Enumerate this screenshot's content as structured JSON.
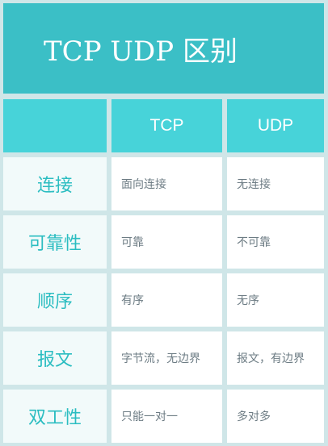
{
  "title": "TCP UDP 区别",
  "columns": [
    "",
    "TCP",
    "UDP"
  ],
  "rows": [
    {
      "label": "连接",
      "tcp": "面向连接",
      "udp": "无连接"
    },
    {
      "label": "可靠性",
      "tcp": "可靠",
      "udp": "不可靠"
    },
    {
      "label": "顺序",
      "tcp": "有序",
      "udp": "无序"
    },
    {
      "label": "报文",
      "tcp": "字节流，无边界",
      "udp": "报文，有边界"
    },
    {
      "label": "双工性",
      "tcp": "只能一对一",
      "udp": "多对多"
    }
  ],
  "colors": {
    "background": "#cfe6e8",
    "title_bg": "#3bbfc6",
    "header_bg": "#47d3d9",
    "label_bg": "#f2fafa",
    "label_text": "#2bbdc1",
    "value_text": "#6d7c84"
  }
}
